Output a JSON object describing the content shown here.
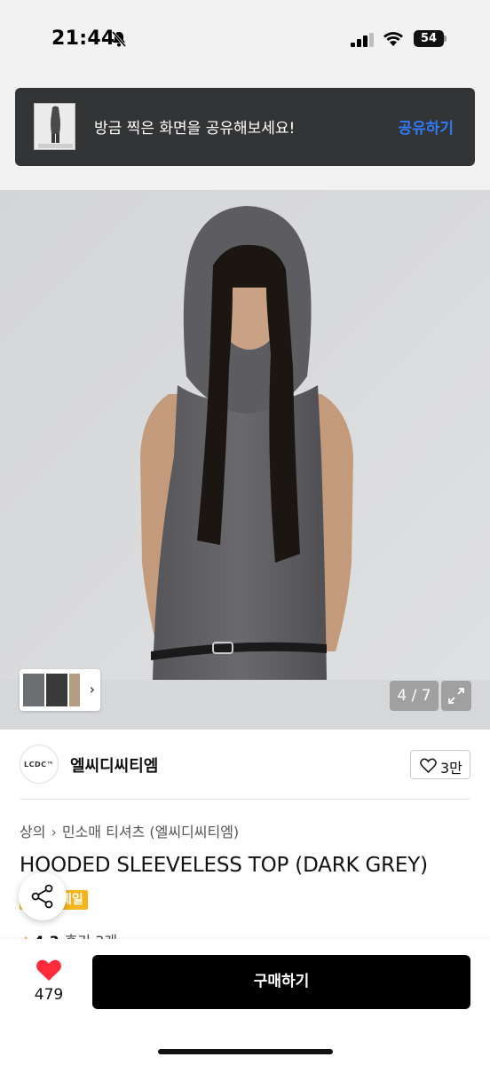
{
  "status_bar": {
    "time": "21:44",
    "battery": "54",
    "icons": [
      "bell-muted-icon",
      "signal-icon",
      "wifi-icon",
      "battery-icon"
    ]
  },
  "toast": {
    "message": "방금 찍은 화면을 공유해보세요!",
    "action": "공유하기",
    "thumbnail_icon": "screenshot-thumbnail"
  },
  "gallery": {
    "counter": "4 / 7",
    "thumb_chevron": "›",
    "expand_icon": "expand-icon"
  },
  "brand": {
    "logo_text": "LCDC™",
    "name": "엘씨디씨티엠",
    "like_count": "3만"
  },
  "breadcrumb": {
    "category": "상의",
    "separator": "›",
    "subcategory": "민소매 티셔츠 (엘씨디씨티엠)"
  },
  "product": {
    "title": "HOODED SLEEVELESS TOP (DARK GREY)",
    "badge": "세일",
    "rating": "4.3",
    "reviews": "후기 3개"
  },
  "bottom_bar": {
    "wish_count": "479",
    "buy_label": "구매하기"
  },
  "colors": {
    "accent_blue": "#2f7bf6",
    "toast_bg": "#333436",
    "badge_yellow": "#f5b41a",
    "heart_red": "#ff2b3a",
    "buy_bg": "#000000"
  }
}
